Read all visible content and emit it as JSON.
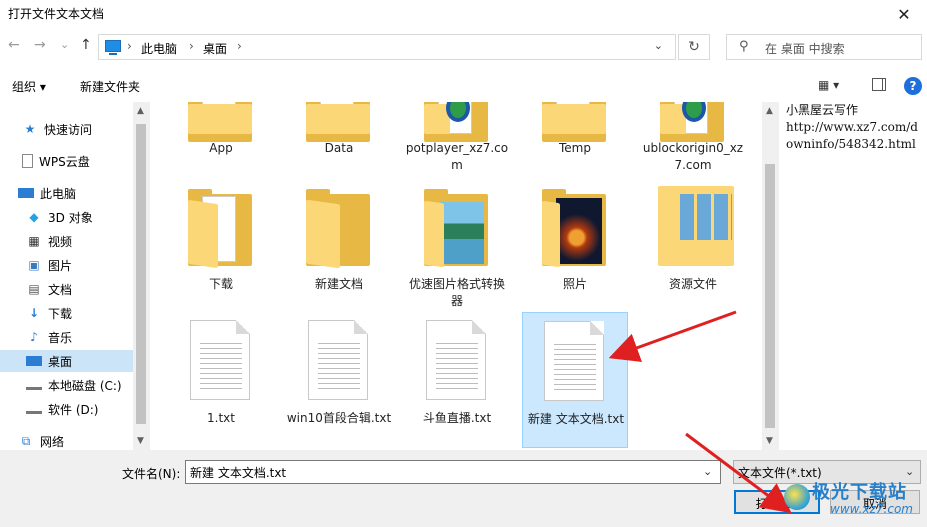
{
  "window": {
    "title": "打开文件文本文档",
    "close_glyph": "✕"
  },
  "nav": {
    "back": "←",
    "forward": "→",
    "recent": "⌄",
    "up": "↑",
    "breadcrumbs": [
      "此电脑",
      "桌面"
    ],
    "refresh_glyph": "↻",
    "search_placeholder": "在 桌面 中搜索"
  },
  "toolbar": {
    "organize": "组织 ▾",
    "new_folder": "新建文件夹",
    "view": "▦ ▾",
    "help": "?"
  },
  "sidebar": {
    "items": [
      {
        "label": "快速访问",
        "icon": "star-icon"
      },
      {
        "label": "WPS云盘",
        "icon": "cloud-doc-icon"
      },
      {
        "label": "此电脑",
        "icon": "computer-icon"
      },
      {
        "label": "3D 对象",
        "icon": "cube-icon"
      },
      {
        "label": "视频",
        "icon": "video-icon"
      },
      {
        "label": "图片",
        "icon": "picture-icon"
      },
      {
        "label": "文档",
        "icon": "document-icon"
      },
      {
        "label": "下载",
        "icon": "download-icon"
      },
      {
        "label": "音乐",
        "icon": "music-icon"
      },
      {
        "label": "桌面",
        "icon": "desktop-icon",
        "selected": true
      },
      {
        "label": "本地磁盘 (C:)",
        "icon": "drive-icon"
      },
      {
        "label": "软件 (D:)",
        "icon": "drive-icon"
      },
      {
        "label": "网络",
        "icon": "network-icon"
      }
    ]
  },
  "files": [
    {
      "name": "App",
      "kind": "folder-doc"
    },
    {
      "name": "Data",
      "kind": "folder-doc"
    },
    {
      "name": "potplayer_xz7.com",
      "kind": "folder-app"
    },
    {
      "name": "Temp",
      "kind": "folder-doc"
    },
    {
      "name": "ublockorigin0_xz7.com",
      "kind": "folder-app"
    },
    {
      "name": "下载",
      "kind": "folder-doc"
    },
    {
      "name": "新建文档",
      "kind": "folder-empty"
    },
    {
      "name": "优速图片格式转换器",
      "kind": "folder-landscape"
    },
    {
      "name": "照片",
      "kind": "folder-fire"
    },
    {
      "name": "资源文件",
      "kind": "folder-grid"
    },
    {
      "name": "1.txt",
      "kind": "txt"
    },
    {
      "name": "win10首段合辑.txt",
      "kind": "txt"
    },
    {
      "name": "斗鱼直播.txt",
      "kind": "txt"
    },
    {
      "name": "新建 文本文档.txt",
      "kind": "txt",
      "selected": true
    }
  ],
  "preview": {
    "lines": [
      "小黑屋云写作",
      "http://www.xz7.com/downinfo/548342.html"
    ]
  },
  "bottom": {
    "filename_label": "文件名(N):",
    "filename_value": "新建 文本文档.txt",
    "filetype_value": "文本文件(*.txt)",
    "open_label": "打开(O)",
    "cancel_label": "取消"
  },
  "watermark": {
    "line1": "极光下载站",
    "line2": "www.xz7.com"
  },
  "colors": {
    "selection": "#cce8ff",
    "accent": "#0078d7",
    "annotation": "#e02020"
  }
}
